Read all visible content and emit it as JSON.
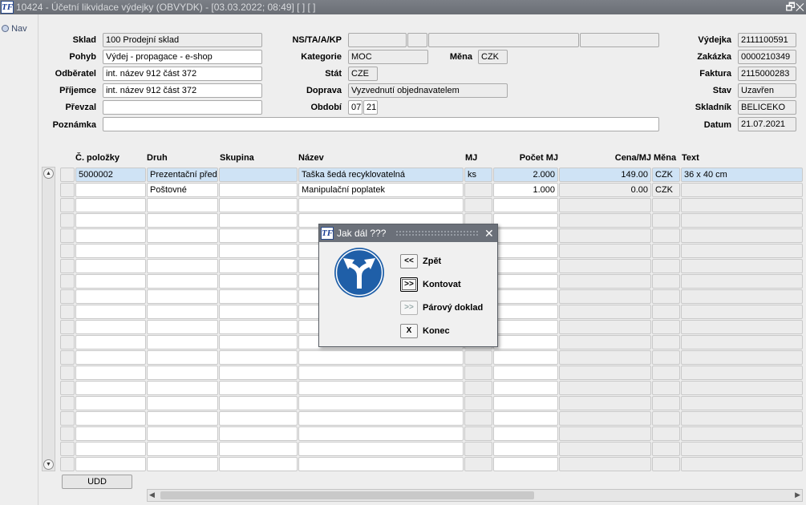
{
  "window": {
    "title": "10424 - Účetní likvidace výdejky (OBVYDK) - [03.03.2022; 08:49] [ ] [ ]",
    "logo": "TF",
    "buttons": "🗗✕"
  },
  "nav": {
    "label": "Nav"
  },
  "form": {
    "sklad": {
      "label": "Sklad",
      "value": "100 Prodejní sklad"
    },
    "pohyb": {
      "label": "Pohyb",
      "value": "Výdej - propagace - e-shop"
    },
    "odberatel": {
      "label": "Odběratel",
      "value": "int. název 912 část 372"
    },
    "prijemce": {
      "label": "Příjemce",
      "value": "int. název 912 část 372"
    },
    "prevzal": {
      "label": "Převzal",
      "value": ""
    },
    "poznamka": {
      "label": "Poznámka",
      "value": ""
    },
    "nstakp": {
      "label": "NS/TA/A/KP"
    },
    "kategorie": {
      "label": "Kategorie",
      "value": "MOC"
    },
    "mena": {
      "label": "Měna",
      "value": "CZK"
    },
    "stat": {
      "label": "Stát",
      "value": "CZE"
    },
    "doprava": {
      "label": "Doprava",
      "value": "Vyzvednutí objednavatelem"
    },
    "obdobi": {
      "label": "Období",
      "month": "07",
      "year": "21"
    },
    "vydejka": {
      "label": "Výdejka",
      "value": "2111100591"
    },
    "zakazka": {
      "label": "Zakázka",
      "value": "0000210349"
    },
    "faktura": {
      "label": "Faktura",
      "value": "2115000283"
    },
    "stav": {
      "label": "Stav",
      "value": "Uzavřen"
    },
    "skladnik": {
      "label": "Skladník",
      "value": "BELICEKO"
    },
    "datum": {
      "label": "Datum",
      "value": "21.07.2021"
    }
  },
  "table": {
    "columns": [
      "Č. položky",
      "Druh",
      "Skupina",
      "Název",
      "MJ",
      "Počet MJ",
      "Cena/MJ",
      "Měna",
      "Text"
    ],
    "rows": [
      [
        "5000002",
        "Prezentační předr",
        "",
        "Taška šedá recyklovatelná",
        "ks",
        "2.000",
        "149.00",
        "CZK",
        "36 x 40 cm"
      ],
      [
        "",
        "Poštovné",
        "",
        "Manipulační poplatek",
        "",
        "1.000",
        "0.00",
        "CZK",
        ""
      ]
    ],
    "empty_rows": 18,
    "selected_row": 0
  },
  "udd_button": "UDD",
  "dialog": {
    "title": "Jak dál ???",
    "close": "✕",
    "sign_icon": "fork-arrow-sign-icon",
    "buttons": [
      {
        "symbol": "<<",
        "label": "Zpět"
      },
      {
        "symbol": ">>",
        "label": "Kontovat"
      },
      {
        "symbol": ">>",
        "label": "Párový doklad"
      },
      {
        "symbol": "X",
        "label": "Konec"
      }
    ]
  },
  "colors": {
    "titlebar": "#6e7279",
    "selection": "#cfe3f5",
    "sign_blue": "#1f5fa8"
  }
}
